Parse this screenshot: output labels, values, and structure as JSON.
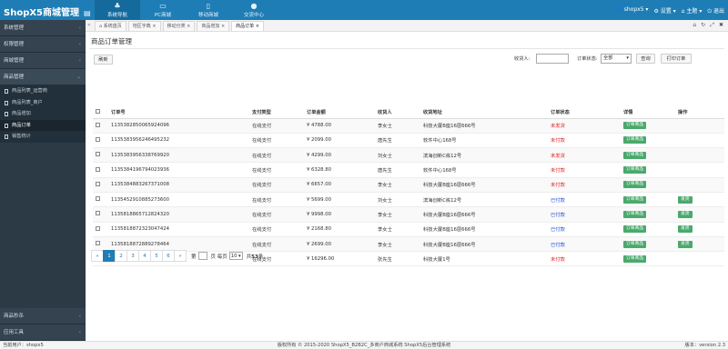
{
  "header": {
    "logo": "ShopX5商城管理",
    "fold_icon": "list-icon",
    "nav": [
      {
        "label": "系统导航",
        "icon": "tree-icon",
        "glyph": "♣"
      },
      {
        "label": "PC商城",
        "icon": "monitor-icon",
        "glyph": "▭"
      },
      {
        "label": "移动商城",
        "icon": "mobile-icon",
        "glyph": "▯"
      },
      {
        "label": "交流中心",
        "icon": "chat-icon",
        "glyph": "●"
      }
    ],
    "user": "shopx5",
    "settings": "设置",
    "home": "主题",
    "exit": "退出"
  },
  "sidebar": {
    "menu": [
      "系统管理",
      "权限管理",
      "商城管理",
      "商品管理"
    ],
    "sub": [
      "商品列表_运营商",
      "商品列表_商户",
      "商品增加",
      "商品订单",
      "销售统计"
    ],
    "bottom": [
      "商品秒杀",
      "应用工具"
    ]
  },
  "tabs": [
    "系统首页",
    "地区字典",
    "移动分类",
    "商品增加",
    "商品订单"
  ],
  "page": {
    "title": "商品订单管理",
    "refresh": "刷新",
    "receiver_label": "收货人:",
    "status_label": "订单状态:",
    "status_value": "全部",
    "search": "查询",
    "print": "打印订单"
  },
  "table": {
    "columns": [
      "订单号",
      "支付类型",
      "订单金额",
      "收货人",
      "收货地址",
      "订单状态",
      "详情",
      "操作"
    ],
    "rows": [
      {
        "id": "1135382850065924096",
        "pay": "在线支付",
        "amount": "¥ 4788.00",
        "name": "李女士",
        "addr": "科技大厦B座16层666号",
        "status": "未发货",
        "sc": "red",
        "detail": "订单商品",
        "op": ""
      },
      {
        "id": "1135383956246495232",
        "pay": "在线支付",
        "amount": "¥ 2099.00",
        "name": "唐先生",
        "addr": "软件中心168号",
        "status": "未付款",
        "sc": "red",
        "detail": "订单商品",
        "op": ""
      },
      {
        "id": "1135383956338769920",
        "pay": "在线支付",
        "amount": "¥ 4299.00",
        "name": "刘女士",
        "addr": "滨海创新C栋12号",
        "status": "未发货",
        "sc": "red",
        "detail": "订单商品",
        "op": ""
      },
      {
        "id": "1135384196794023936",
        "pay": "在线支付",
        "amount": "¥ 6328.80",
        "name": "唐先生",
        "addr": "软件中心168号",
        "status": "未付款",
        "sc": "red",
        "detail": "订单商品",
        "op": ""
      },
      {
        "id": "1135384883267371008",
        "pay": "在线支付",
        "amount": "¥ 6657.00",
        "name": "李女士",
        "addr": "科技大厦B座16层666号",
        "status": "未付款",
        "sc": "red",
        "detail": "订单商品",
        "op": ""
      },
      {
        "id": "1135452910885273600",
        "pay": "在线支付",
        "amount": "¥ 5699.00",
        "name": "刘女士",
        "addr": "滨海创新C栋12号",
        "status": "已付款",
        "sc": "blue",
        "detail": "订单商品",
        "op": "发货"
      },
      {
        "id": "1135818865712824320",
        "pay": "在线支付",
        "amount": "¥ 9998.00",
        "name": "李女士",
        "addr": "科技大厦B座16层666号",
        "status": "已付款",
        "sc": "blue",
        "detail": "订单商品",
        "op": "发货"
      },
      {
        "id": "1135818872323047424",
        "pay": "在线支付",
        "amount": "¥ 2168.80",
        "name": "李女士",
        "addr": "科技大厦B座16层666号",
        "status": "已付款",
        "sc": "blue",
        "detail": "订单商品",
        "op": "发货"
      },
      {
        "id": "1135818872889278464",
        "pay": "在线支付",
        "amount": "¥ 2699.00",
        "name": "李女士",
        "addr": "科技大厦B座16层666号",
        "status": "已付款",
        "sc": "blue",
        "detail": "订单商品",
        "op": "发货"
      },
      {
        "id": "1173056031371034624",
        "pay": "在线支付",
        "amount": "¥ 16296.00",
        "name": "张先生",
        "addr": "科技大厦1号",
        "status": "未付款",
        "sc": "red",
        "detail": "订单商品",
        "op": ""
      }
    ]
  },
  "pager": {
    "first": "«",
    "pages": [
      "1",
      "2",
      "3",
      "4",
      "5",
      "6"
    ],
    "last": "»",
    "goto_prefix": "第",
    "goto_suffix": "页 每页",
    "page_size": "10",
    "total_prefix": "共",
    "total": "53",
    "total_suffix": "条"
  },
  "footer": {
    "left": "当前用户：shopx5",
    "center": "版权所有 © 2015-2020 ShopX5_B2B2C_多商户商城系统 ShopX5后台管理系统",
    "right": "版本：version 2.3"
  },
  "colors": {
    "accent": "#1f7db5",
    "sidebar": "#2c3a46",
    "unpaid": "#e02020",
    "paid": "#1f4fd8",
    "green_button": "#4aa96c"
  }
}
